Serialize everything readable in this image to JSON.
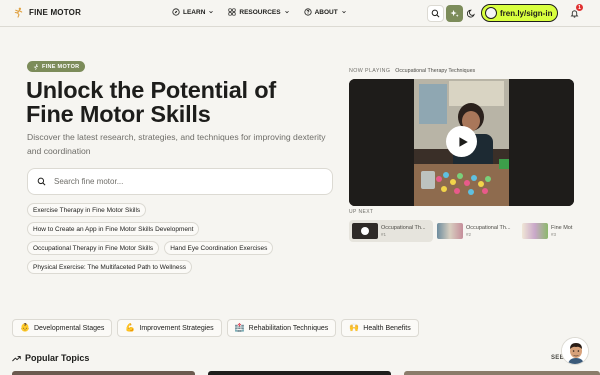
{
  "header": {
    "brand": "FINE MOTOR",
    "nav": [
      {
        "label": "LEARN",
        "icon": "compass-icon"
      },
      {
        "label": "RESOURCES",
        "icon": "grid-icon"
      },
      {
        "label": "ABOUT",
        "icon": "help-circle-icon"
      }
    ],
    "signin_label": "fren.ly/sign-in",
    "notification_count": "1"
  },
  "hero": {
    "badge": "FINE MOTOR",
    "title": "Unlock the Potential of Fine Motor Skills",
    "subtitle": "Discover the latest research, strategies, and techniques for improving dexterity and coordination",
    "search_placeholder": "Search fine motor...",
    "chips": [
      "Exercise Therapy in Fine Motor Skills",
      "How to Create an App in Fine Motor Skills Development",
      "Occupational Therapy in Fine Motor Skills",
      "Hand Eye Coordination Exercises",
      "Physical Exercise: The Multifaceted Path to Wellness"
    ]
  },
  "video": {
    "now_playing_label": "NOW PLAYING",
    "now_playing_title": "Occupational Therapy Techniques",
    "up_next_label": "UP NEXT",
    "up_next": [
      {
        "title": "Occupational Th...",
        "num": "#1"
      },
      {
        "title": "Occupational Th...",
        "num": "#2"
      },
      {
        "title": "Fine Mot",
        "num": "#3"
      }
    ]
  },
  "categories": [
    {
      "label": "Developmental Stages",
      "icon": "baby-emoji",
      "glyph": "👶"
    },
    {
      "label": "Improvement Strategies",
      "icon": "flexed-arm-emoji",
      "glyph": "💪"
    },
    {
      "label": "Rehabilitation Techniques",
      "icon": "hospital-emoji",
      "glyph": "🏥"
    },
    {
      "label": "Health Benefits",
      "icon": "person-raising-hands-emoji",
      "glyph": "🙌"
    }
  ],
  "popular": {
    "title": "Popular Topics",
    "see_all": "SEE"
  },
  "colors": {
    "background": "#f6f5f1",
    "accent_olive": "#7c8c5a",
    "signin_lime": "#d8ff3e",
    "badge_red": "#e03131"
  }
}
